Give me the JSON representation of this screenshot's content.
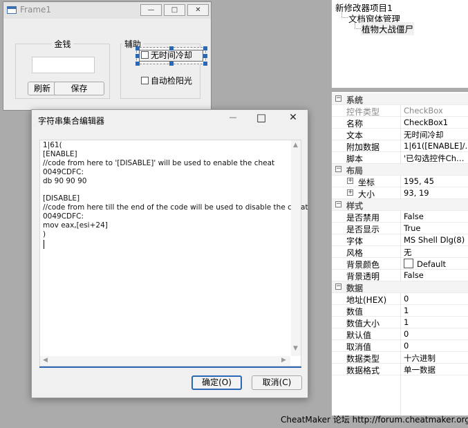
{
  "frame1": {
    "title": "Frame1",
    "min_glyph": "—",
    "max_glyph": "□",
    "close_glyph": "✕",
    "money_group": "金钱",
    "money_value": "",
    "refresh_btn": "刷新",
    "save_btn": "保存",
    "assist_group": "辅助",
    "checkbox_cooldown": "无时间冷却",
    "checkbox_sun": "自动检阳光"
  },
  "dialog": {
    "title": "字符串集合编辑器",
    "min_glyph": "—",
    "max_glyph": "□",
    "close_glyph": "✕",
    "editor_text": "1|61(\n[ENABLE]\n//code from here to '[DISABLE]' will be used to enable the cheat\n0049CDFC:\ndb 90 90 90\n\n[DISABLE]\n//code from here till the end of the code will be used to disable the cheat\n0049CDFC:\nmov eax,[esi+24]\n)",
    "ok_btn": "确定(O)",
    "cancel_btn": "取消(C)"
  },
  "tree": {
    "root": "新修改器项目1",
    "child": "文档窗体管理",
    "leaf": "植物大战僵尸"
  },
  "properties": {
    "cat_system": "系统",
    "control_type_label": "控件类型",
    "control_type_value": "CheckBox",
    "name_label": "名称",
    "name_value": "CheckBox1",
    "text_label": "文本",
    "text_value": "无时间冷却",
    "extra_label": "附加数据",
    "extra_value": "1|61([ENABLE]/…",
    "script_label": "脚本",
    "script_value": "'已勾选控件Ch…",
    "cat_layout": "布局",
    "coord_label": "坐标",
    "coord_value": "195, 45",
    "size_label": "大小",
    "size_value": "93, 19",
    "cat_style": "样式",
    "disabled_label": "是否禁用",
    "disabled_value": "False",
    "visible_label": "是否显示",
    "visible_value": "True",
    "font_label": "字体",
    "font_value": "MS Shell Dlg(8)",
    "style_label": "风格",
    "style_value": "无",
    "bgcolor_label": "背景颜色",
    "bgcolor_value": "Default",
    "bgtrans_label": "背景透明",
    "bgtrans_value": "False",
    "cat_data": "数据",
    "addr_label": "地址(HEX)",
    "addr_value": "0",
    "num_label": "数值",
    "num_value": "1",
    "numsize_label": "数值大小",
    "numsize_value": "1",
    "default_label": "默认值",
    "default_value": "0",
    "cancelval_label": "取消值",
    "cancelval_value": "0",
    "dtype_label": "数据类型",
    "dtype_value": "十六进制",
    "dformat_label": "数据格式",
    "dformat_value": "单一数据"
  },
  "footer": "CheatMaker 论坛 http://forum.cheatmaker.org/",
  "colors": {
    "accent": "#2a67b5",
    "canvas": "#ababab"
  }
}
